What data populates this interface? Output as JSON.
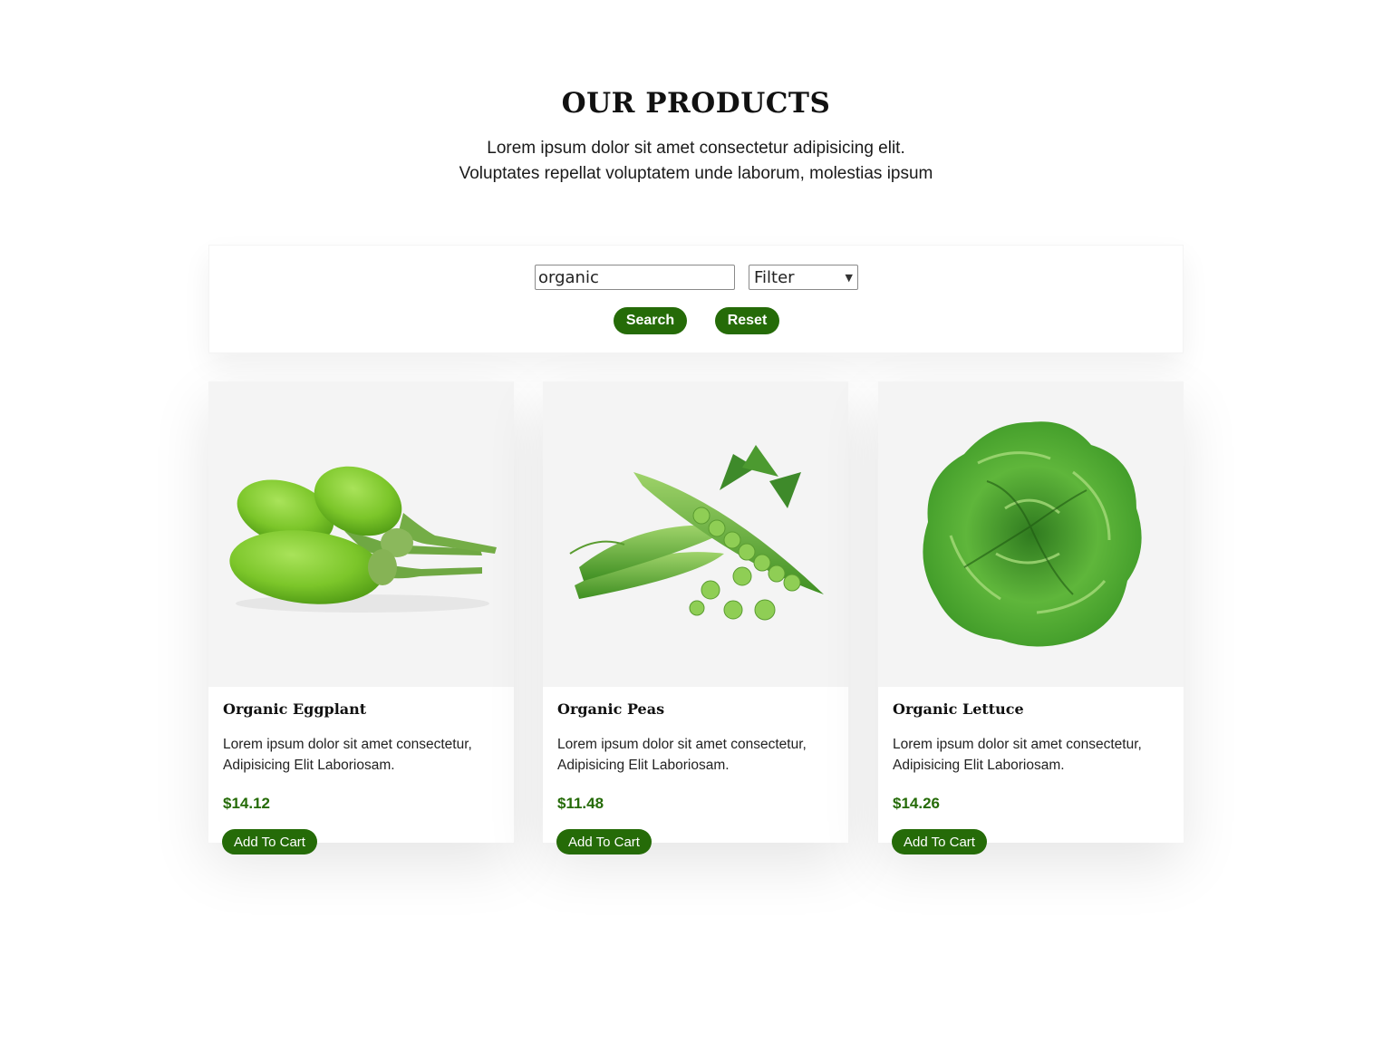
{
  "header": {
    "title": "OUR PRODUCTS",
    "intro_line1": "Lorem ipsum dolor sit amet consectetur adipisicing elit.",
    "intro_line2": "Voluptates repellat voluptatem unde laborum, molestias ipsum"
  },
  "search": {
    "query": "organic",
    "filter_selected": "Filter",
    "search_label": "Search",
    "reset_label": "Reset"
  },
  "products": [
    {
      "name": "Organic Eggplant",
      "desc_line1": "Lorem ipsum dolor sit amet consectetur,",
      "desc_line2": "Adipisicing Elit Laboriosam.",
      "price": "$14.12",
      "cart_label": "Add To Cart",
      "image": "eggplant-image"
    },
    {
      "name": "Organic Peas",
      "desc_line1": "Lorem ipsum dolor sit amet consectetur,",
      "desc_line2": "Adipisicing Elit Laboriosam.",
      "price": "$11.48",
      "cart_label": "Add To Cart",
      "image": "peas-image"
    },
    {
      "name": "Organic Lettuce",
      "desc_line1": "Lorem ipsum dolor sit amet consectetur,",
      "desc_line2": "Adipisicing Elit Laboriosam.",
      "price": "$14.26",
      "cart_label": "Add To Cart",
      "image": "lettuce-image"
    }
  ],
  "colors": {
    "accent": "#256b08",
    "card_image_bg": "#f4f4f4"
  }
}
